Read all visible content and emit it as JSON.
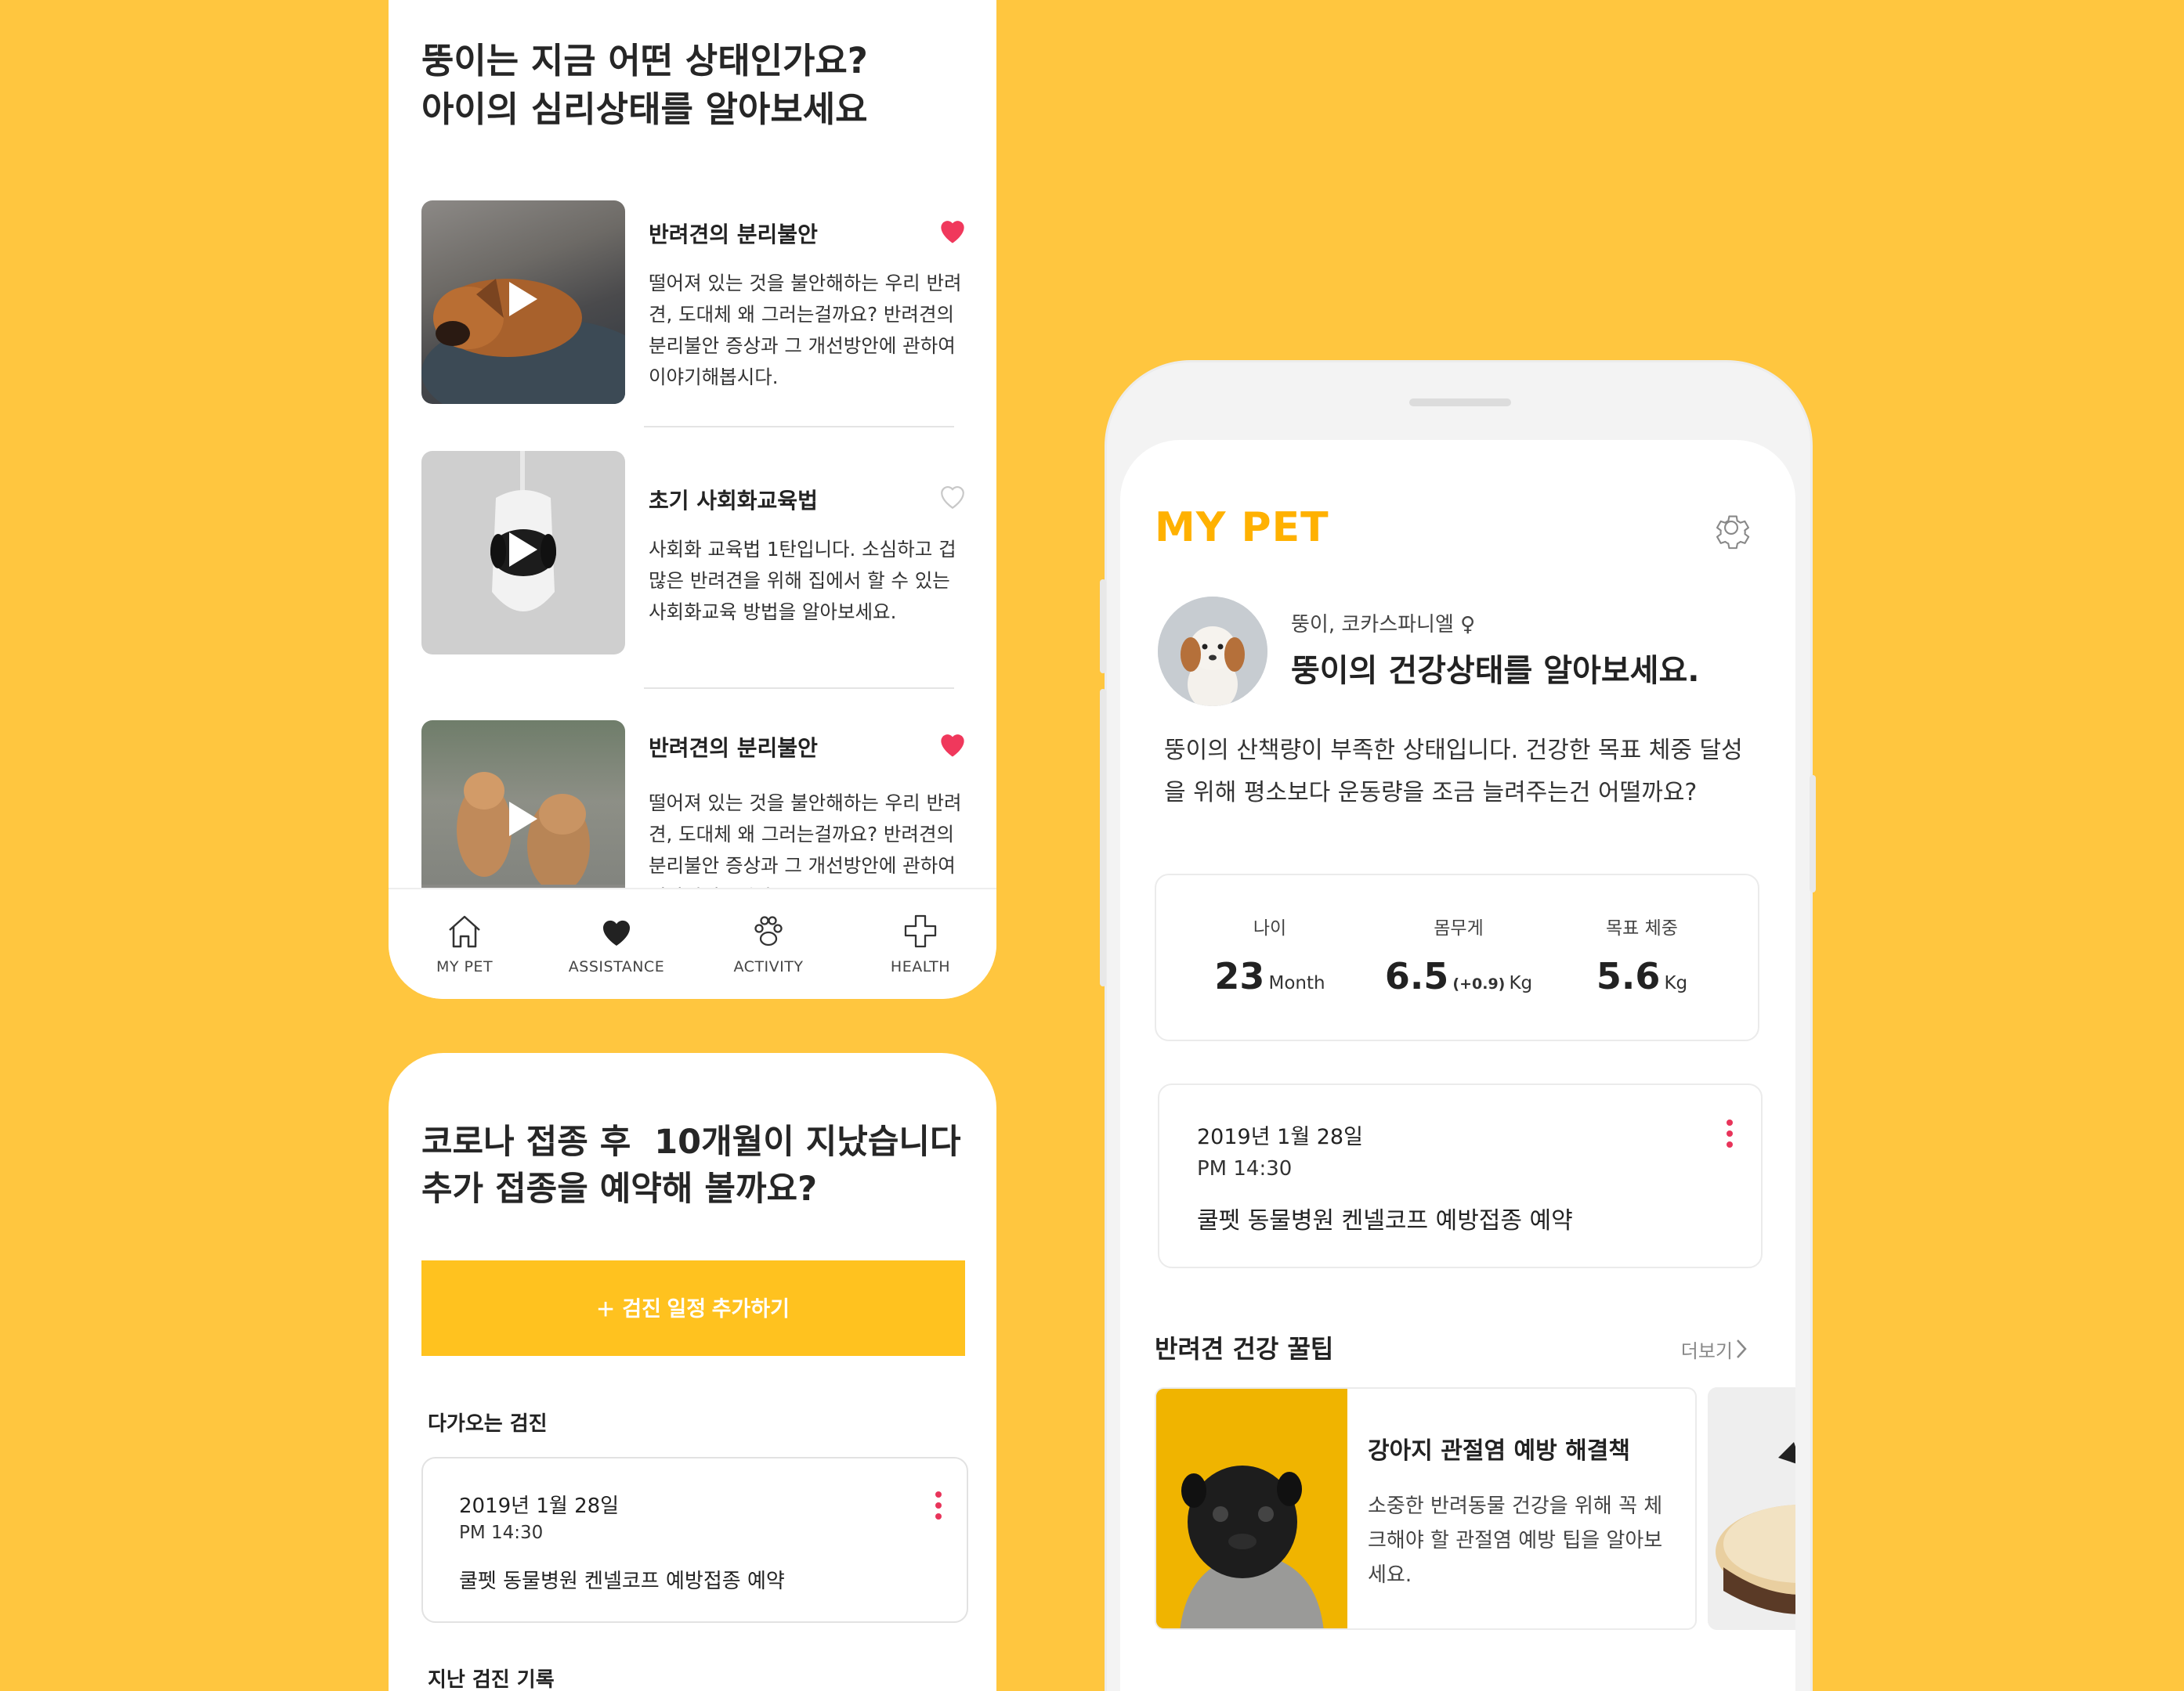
{
  "left_panel": {
    "title_line1": "뚱이는 지금 어떤 상태인가요?",
    "title_line2": "아이의 심리상태를 알아보세요",
    "articles": [
      {
        "title": "반려견의 분리불안",
        "description": "떨어져 있는 것을 불안해하는 우리 반려견, 도대체 왜 그러는걸까요? 반려견의 분리불안 증상과 그 개선방안에 관하여 이야기해봅시다.",
        "liked": true,
        "icon": "heart-filled-icon"
      },
      {
        "title": "초기 사회화교육법",
        "description": "사회화 교육법 1탄입니다. 소심하고 겁많은 반려견을 위해 집에서 할 수 있는 사회화교육 방법을 알아보세요.",
        "liked": false,
        "icon": "heart-outline-icon"
      },
      {
        "title": "반려견의 분리불안",
        "description": "떨어져 있는 것을 불안해하는 우리 반려견, 도대체 왜 그러는걸까요? 반려견의 분리불안 증상과 그 개선방안에 관하여 이야기해봅시다.",
        "liked": true,
        "icon": "heart-filled-icon"
      }
    ],
    "tabs": [
      {
        "label": "MY PET",
        "icon": "home-icon"
      },
      {
        "label": "ASSISTANCE",
        "icon": "heart-icon"
      },
      {
        "label": "ACTIVITY",
        "icon": "paw-icon"
      },
      {
        "label": "HEALTH",
        "icon": "medical-cross-icon"
      }
    ]
  },
  "checkup_panel": {
    "title_line1": "코로나 접종 후  10개월이 지났습니다",
    "title_line2": "추가 접종을 예약해 볼까요?",
    "add_button_label": "검진 일정 추가하기",
    "upcoming_label": "다가오는 검진",
    "upcoming": {
      "date": "2019년 1월 28일",
      "time": "PM 14:30",
      "description": "쿨펫 동물병원 켄넬코프 예방접종 예약"
    },
    "history_label": "지난 검진 기록"
  },
  "phone": {
    "title": "MY PET",
    "pet_subtitle": "뚱이, 코카스파니엘 ♀",
    "headline": "뚱이의 건강상태를 알아보세요.",
    "message": "뚱이의 산책량이 부족한 상태입니다. 건강한 목표 체중 달성을 위해 평소보다 운동량을 조금 늘려주는건 어떨까요?",
    "stats": {
      "age": {
        "label": "나이",
        "value": "23",
        "unit": "Month"
      },
      "weight": {
        "label": "몸무게",
        "value": "6.5",
        "delta": "(+0.9)",
        "unit": "Kg"
      },
      "target": {
        "label": "목표 체중",
        "value": "5.6",
        "unit": "Kg"
      }
    },
    "schedule": {
      "date": "2019년 1월 28일",
      "time": "PM 14:30",
      "description": "쿨펫 동물병원 켄넬코프 예방접종 예약"
    },
    "tips_title": "반려견 건강 꿀팁",
    "more_label": "더보기",
    "tip": {
      "title": "강아지 관절염 예방 해결책",
      "description": "소중한 반려동물 건강을 위해 꼭 체크해야 할 관절염 예방 팁을 알아보세요."
    }
  },
  "colors": {
    "background": "#FFC63F",
    "accent": "#FFB100",
    "button": "#FFC21F",
    "heart": "#F0385C"
  }
}
